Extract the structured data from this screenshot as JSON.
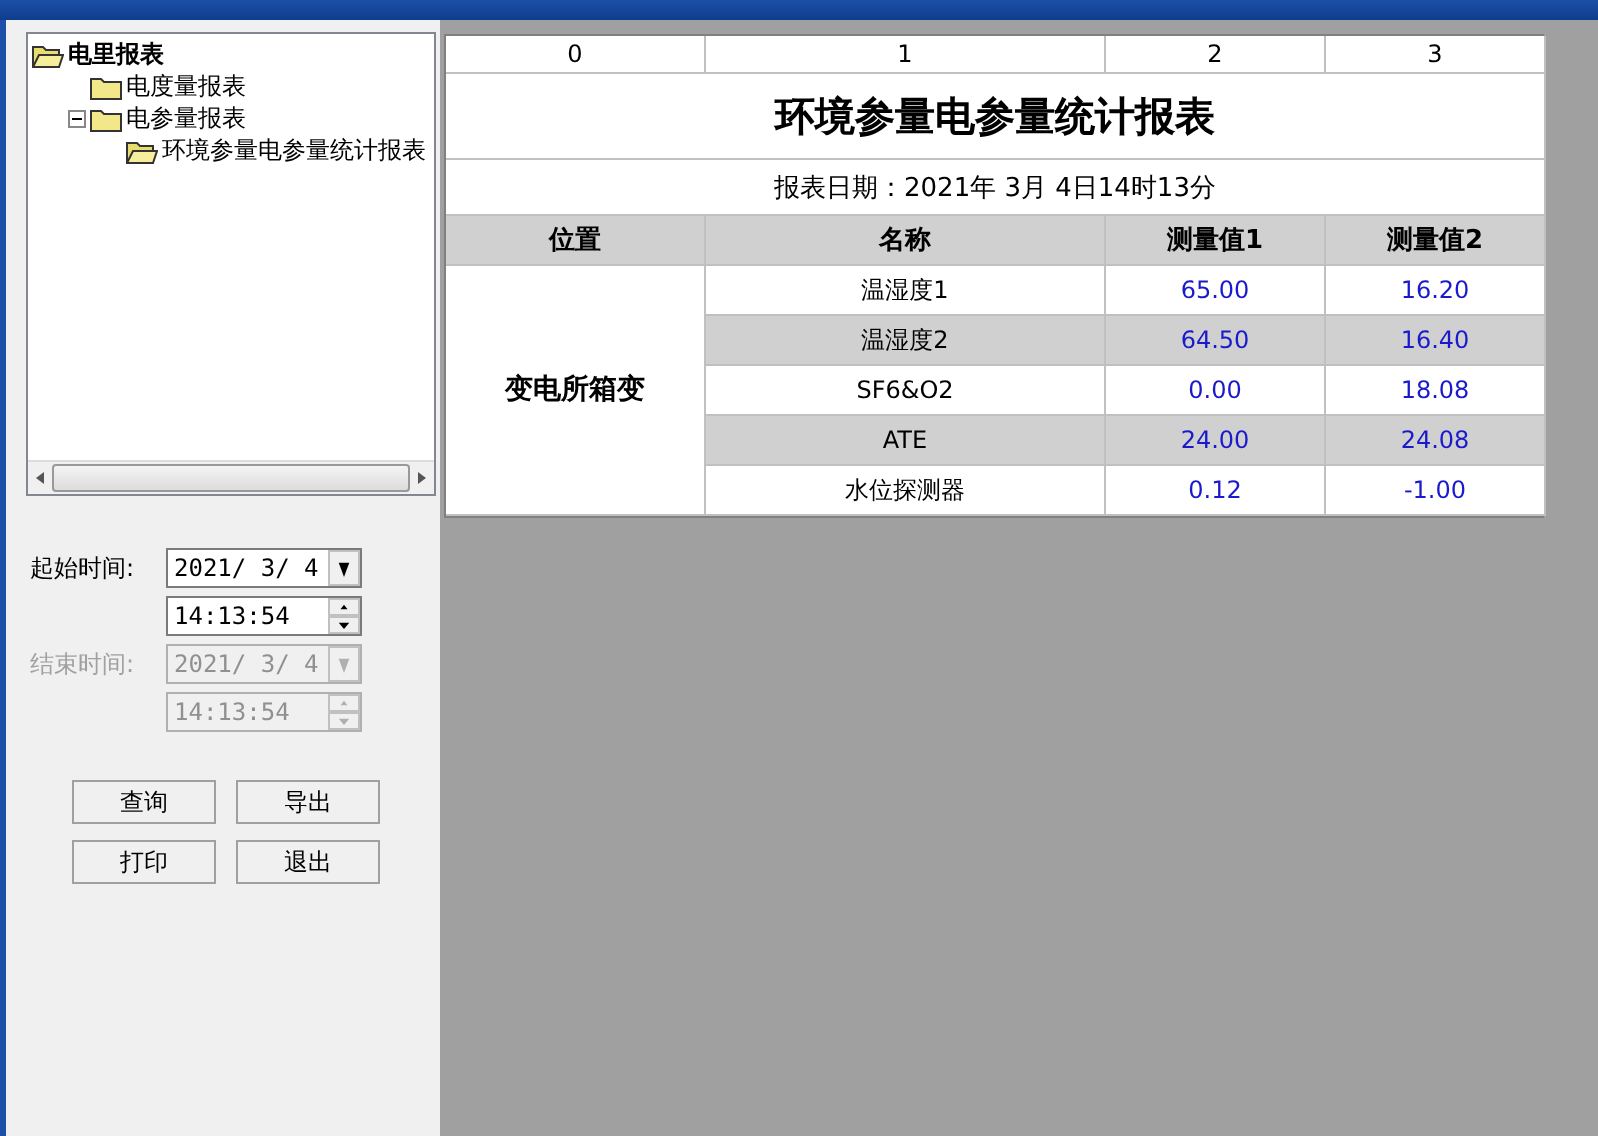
{
  "tree": [
    {
      "label": "电里报表",
      "expanded": true,
      "children": [
        {
          "label": "电度量报表",
          "selected": false
        },
        {
          "label": "电参量报表",
          "expanded": true,
          "selected": false,
          "children": [
            {
              "label": "环境参量电参量统计报表",
              "selected": true
            }
          ]
        }
      ]
    }
  ],
  "time_range": [
    {
      "label": "起始时间:",
      "date": "2021/ 3/ 4",
      "time": "14:13:54",
      "disabled": false
    },
    {
      "label": "结束时间:",
      "date": "2021/ 3/ 4",
      "time": "14:13:54",
      "disabled": true
    }
  ],
  "buttons": [
    "查询",
    "导出",
    "打印",
    "退出"
  ],
  "report": {
    "column_numbers": [
      "0",
      "1",
      "2",
      "3"
    ],
    "title": "环境参量电参量统计报表",
    "date_line": "报表日期：2021年 3月 4日14时13分",
    "columns": [
      "位置",
      "名称",
      "测量值1",
      "测量值2"
    ],
    "location": "变电所箱变",
    "rows": [
      {
        "name": "温湿度1",
        "value_1": "65.00",
        "value_2": "16.20"
      },
      {
        "name": "温湿度2",
        "value_1": "64.50",
        "value_2": "16.40"
      },
      {
        "name": "SF6&O2",
        "value_1": "0.00",
        "value_2": "18.08"
      },
      {
        "name": "ATE",
        "value_1": "24.00",
        "value_2": "24.08"
      },
      {
        "name": "水位探测器",
        "value_1": "0.12",
        "value_2": "-1.00"
      }
    ]
  }
}
